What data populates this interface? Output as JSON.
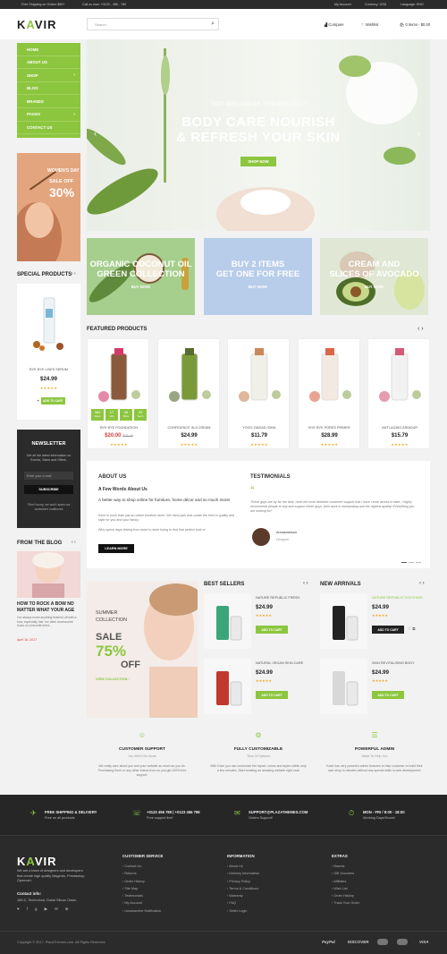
{
  "topbar": {
    "shipping": "Free Shipping on Orders $50+",
    "call": "Call us now: +0123 - 456 - 789",
    "account": "My Account",
    "currency": "Currency: USD",
    "language": "Language: ENG"
  },
  "header": {
    "logo_k": "K",
    "logo_a": "A",
    "logo_rest": "VIR",
    "search_placeholder": "Search...",
    "compare": "Compare",
    "wishlist": "Wishlist",
    "cart": "0 items - $0.00"
  },
  "nav": {
    "items": [
      {
        "label": "HOME",
        "arrow": ""
      },
      {
        "label": "ABOUT US",
        "arrow": ""
      },
      {
        "label": "SHOP",
        "arrow": "›"
      },
      {
        "label": "BLOG",
        "arrow": ""
      },
      {
        "label": "BRANDS",
        "arrow": ""
      },
      {
        "label": "PAGES",
        "arrow": "›"
      },
      {
        "label": "CONTACT US",
        "arrow": ""
      }
    ]
  },
  "hero": {
    "subtitle": "TOP WELLNESS TRENDS 2017",
    "title_line1": "BODY CARE NOURISH",
    "title_line2": "& REFRESH YOUR SKIN",
    "button": "SHOP NOW"
  },
  "side_promo": {
    "line1": "WOMEN'S DAY",
    "line2": "SALE OFF",
    "line3": "30%"
  },
  "banners": [
    {
      "title_line1": "ORGANIC COCONUT OIL",
      "title_line2": "GREEN COLLECTION",
      "button": "BUY NOW!"
    },
    {
      "title_line1": "BUY 2 ITEMS",
      "title_line2": "GET ONE FOR FREE",
      "button": "BUY NOW!"
    },
    {
      "title_line1": "CREAM AND",
      "title_line2": "SLICES OF AVOCADO",
      "button": "BUY NOW!"
    }
  ],
  "special": {
    "title": "SPECIAL PRODUCTS",
    "name": "BYE BYE LINES SERUM",
    "price": "$24.99",
    "stars": "★★★★★",
    "add_to_cart": "ADD TO CART"
  },
  "newsletter": {
    "title": "NEWSLETTER",
    "text": "Get all the latest information on Events, Sales and Offers.",
    "placeholder": "Enter your e-mail",
    "button": "SUBSCRIBE",
    "note": "*Don't worry, we won't spam our customers mailboxes"
  },
  "blog": {
    "title": "FROM THE BLOG",
    "post_title": "HOW TO ROCK A BOW NO MATTER WHAT YOUR AGE",
    "post_text": "I've always loved anything finished off with a bow, especially hair. Ive often accessorize bows on a favorite trend...",
    "date": "April 18, 2017"
  },
  "featured": {
    "title": "FEATURED PRODUCTS",
    "countdown": {
      "days": "360",
      "days_l": "Days",
      "hours": "17",
      "hours_l": "Hrs",
      "mins": "48",
      "mins_l": "Mins",
      "secs": "29",
      "secs_l": "Secs"
    },
    "products": [
      {
        "name": "BYE BYE FOUNDATION",
        "price": "$20.00",
        "old": "$25.46",
        "stars": "★★★★★"
      },
      {
        "name": "CONFIDENCE IN A CREAM",
        "price": "$24.99",
        "old": "",
        "stars": "★★★★★"
      },
      {
        "name": "YOGG ZIADAD GIMIL",
        "price": "$11.79",
        "old": "",
        "stars": "★★★★★"
      },
      {
        "name": "BYE BYE PORES PRIMER",
        "price": "$28.99",
        "old": "",
        "stars": "★★★★★"
      },
      {
        "name": "ANTI-AGING ARMOUR",
        "price": "$15.79",
        "old": "",
        "stars": "★★★★★"
      }
    ]
  },
  "about": {
    "title": "ABOUT US",
    "subtitle": "A Few Words About Us",
    "text1": "A better way to shop online for furniture, home décor and so much more!",
    "text2": "Kavir is more than just an online furniture store. We hand pick and curate the best in quality and style for you and your family.",
    "text3": "Why spend days driving from store to store trying to find that perfect look or",
    "button": "LEARN MORE"
  },
  "testimonials": {
    "title": "TESTIMONIALS",
    "quote": "These guys are by far the best, have the most fantastic customer support that I have come across to date, I highly recommend people to buy and support these guys, their work is outstanding and the highest quality! Everything you are looking for!",
    "author": "Annasmeison",
    "role": "Designer"
  },
  "summer": {
    "line1": "SUMMER",
    "line2": "COLLECTION",
    "sale": "SALE",
    "percent": "75%",
    "off": "OFF",
    "link": "VIEW COLLECTION ›"
  },
  "best_sellers": {
    "title": "BEST SELLERS",
    "items": [
      {
        "name": "NATURE REPUBLIC FRESH",
        "price": "$24.99",
        "stars": "★★★★★",
        "button": "ADD TO CART"
      },
      {
        "name": "NATURAL VEGAN SKIN CARE",
        "price": "$24.99",
        "stars": "★★★★★",
        "button": "ADD TO CART"
      }
    ]
  },
  "new_arrivals": {
    "title": "NEW ARRIVALS",
    "items": [
      {
        "name": "NATURE REPUBLIC SOOTHING",
        "price": "$24.99",
        "stars": "★★★★★",
        "button": "ADD TO CART"
      },
      {
        "name": "SKIN REVITALISING BODY",
        "price": "$24.99",
        "stars": "★★★★★",
        "button": "ADD TO CART"
      }
    ]
  },
  "features": [
    {
      "title": "CUSTOMER SUPPORT",
      "sub": "You Won't Be Alone",
      "text": "We really care about you and your website as much as you do. Purchasing Kavir or any other theme from us you get 100% free support."
    },
    {
      "title": "FULLY CUSTOMIZABLE",
      "sub": "Tons Of Options",
      "text": "With Kavir you can customize the layout, colors and styles within only a few minutes. Start creating an amazing website right now!"
    },
    {
      "title": "POWERFUL ADMIN",
      "sub": "Made To Help You",
      "text": "Kavir has very powerful admin features to help customer to build their own shop in minutes without any special skills in web development."
    }
  ],
  "footer_top": [
    {
      "title": "FREE SHIPPING & DELIVERY",
      "sub": "Free on all products"
    },
    {
      "title": "+0123 456 789 | +0123 456 789",
      "sub": "Free support line!"
    },
    {
      "title": "SUPPORT@PLAZATHEMES.COM",
      "sub": "Orders Support!"
    },
    {
      "title": "MON - FRI / 8:00 - 18:00",
      "sub": "Working Days/Hours!"
    }
  ],
  "footer": {
    "about_text": "We are a team of designers and developers that create high quality Magento, Prestashop, Opencart.",
    "contact_title": "Contact info:",
    "contact_text": "169-C, Technohub, Dubai Silicon Oasis.",
    "copyright": "Copyright © 2017, PlazaThemes.com. All Rights Reserved.",
    "col1_title": "CUSTOMER SERVICE",
    "col1": [
      "Contact Us",
      "Returns",
      "Order History",
      "Site Map",
      "Testimonials",
      "My Account",
      "Unsubscribe Notification"
    ],
    "col2_title": "INFORMATION",
    "col2": [
      "About Us",
      "Delivery Information",
      "Privacy Policy",
      "Terms & Conditions",
      "Warranty",
      "FAQ",
      "Seller Login"
    ],
    "col3_title": "EXTRAS",
    "col3": [
      "Brands",
      "Gift Vouchers",
      "Affiliates",
      "Wish List",
      "Order History",
      "Track Your Order"
    ],
    "payments": [
      "PayPal",
      "DISCOVER",
      "VISA"
    ]
  },
  "colors": {
    "accent": "#8cc63f",
    "dark": "#2b2b2b",
    "price_red": "#e23c3c"
  }
}
